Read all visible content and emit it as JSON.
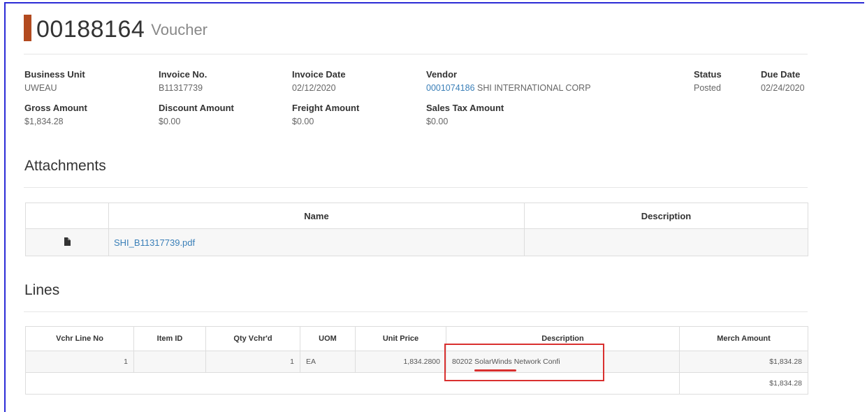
{
  "header": {
    "voucher_id": "00188164",
    "type_label": "Voucher"
  },
  "summary": {
    "business_unit": {
      "label": "Business Unit",
      "value": "UWEAU"
    },
    "invoice_no": {
      "label": "Invoice No.",
      "value": "B11317739"
    },
    "invoice_date": {
      "label": "Invoice Date",
      "value": "02/12/2020"
    },
    "vendor": {
      "label": "Vendor",
      "id": "0001074186",
      "name": "SHI INTERNATIONAL CORP"
    },
    "status": {
      "label": "Status",
      "value": "Posted"
    },
    "due_date": {
      "label": "Due Date",
      "value": "02/24/2020"
    },
    "gross_amount": {
      "label": "Gross Amount",
      "value": "$1,834.28"
    },
    "discount_amount": {
      "label": "Discount Amount",
      "value": "$0.00"
    },
    "freight_amount": {
      "label": "Freight Amount",
      "value": "$0.00"
    },
    "sales_tax_amount": {
      "label": "Sales Tax Amount",
      "value": "$0.00"
    }
  },
  "attachments": {
    "title": "Attachments",
    "columns": {
      "icon": "",
      "name": "Name",
      "description": "Description"
    },
    "rows": [
      {
        "icon": "file-icon",
        "name": "SHI_B11317739.pdf",
        "description": ""
      }
    ]
  },
  "lines": {
    "title": "Lines",
    "columns": {
      "line_no": "Vchr Line No",
      "item_id": "Item ID",
      "qty": "Qty Vchr'd",
      "uom": "UOM",
      "unit_price": "Unit Price",
      "description": "Description",
      "merch_amount": "Merch Amount"
    },
    "rows": [
      {
        "line_no": "1",
        "item_id": "",
        "qty": "1",
        "uom": "EA",
        "unit_price": "1,834.2800",
        "description": "80202 SolarWinds Network Confi",
        "merch_amount": "$1,834.28"
      }
    ],
    "total": "$1,834.28"
  },
  "colors": {
    "accent": "#b24a1f",
    "link": "#3a7fb8",
    "annotation": "#d9302f",
    "frame": "#2b2bd6"
  }
}
